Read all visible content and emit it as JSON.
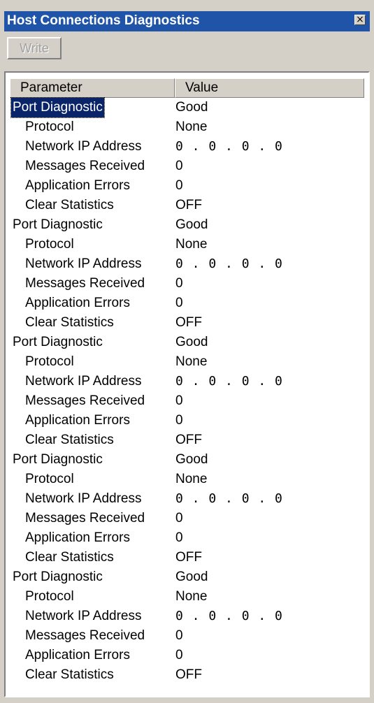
{
  "window": {
    "title": "Host Connections Diagnostics",
    "close_glyph": "×"
  },
  "toolbar": {
    "write_label": "Write"
  },
  "table": {
    "columns": [
      "Parameter",
      "Value"
    ],
    "rows": [
      {
        "parameter": "Port Diagnostic",
        "value": "Good",
        "level": 0,
        "selected": true
      },
      {
        "parameter": "Protocol",
        "value": "None",
        "level": 1
      },
      {
        "parameter": "Network IP Address",
        "value": "0 . 0 . 0 . 0",
        "level": 1
      },
      {
        "parameter": "Messages Received",
        "value": "0",
        "level": 1
      },
      {
        "parameter": "Application Errors",
        "value": "0",
        "level": 1
      },
      {
        "parameter": "Clear Statistics",
        "value": "OFF",
        "level": 1
      },
      {
        "parameter": "Port Diagnostic",
        "value": "Good",
        "level": 0
      },
      {
        "parameter": "Protocol",
        "value": "None",
        "level": 1
      },
      {
        "parameter": "Network IP Address",
        "value": "0 . 0 . 0 . 0",
        "level": 1
      },
      {
        "parameter": "Messages Received",
        "value": "0",
        "level": 1
      },
      {
        "parameter": "Application Errors",
        "value": "0",
        "level": 1
      },
      {
        "parameter": "Clear Statistics",
        "value": "OFF",
        "level": 1
      },
      {
        "parameter": "Port Diagnostic",
        "value": "Good",
        "level": 0
      },
      {
        "parameter": "Protocol",
        "value": "None",
        "level": 1
      },
      {
        "parameter": "Network IP Address",
        "value": "0 . 0 . 0 . 0",
        "level": 1
      },
      {
        "parameter": "Messages Received",
        "value": "0",
        "level": 1
      },
      {
        "parameter": "Application Errors",
        "value": "0",
        "level": 1
      },
      {
        "parameter": "Clear Statistics",
        "value": "OFF",
        "level": 1
      },
      {
        "parameter": "Port Diagnostic",
        "value": "Good",
        "level": 0
      },
      {
        "parameter": "Protocol",
        "value": "None",
        "level": 1
      },
      {
        "parameter": "Network IP Address",
        "value": "0 . 0 . 0 . 0",
        "level": 1
      },
      {
        "parameter": "Messages Received",
        "value": "0",
        "level": 1
      },
      {
        "parameter": "Application Errors",
        "value": "0",
        "level": 1
      },
      {
        "parameter": "Clear Statistics",
        "value": "OFF",
        "level": 1
      },
      {
        "parameter": "Port Diagnostic",
        "value": "Good",
        "level": 0
      },
      {
        "parameter": "Protocol",
        "value": "None",
        "level": 1
      },
      {
        "parameter": "Network IP Address",
        "value": "0 . 0 . 0 . 0",
        "level": 1
      },
      {
        "parameter": "Messages Received",
        "value": "0",
        "level": 1
      },
      {
        "parameter": "Application Errors",
        "value": "0",
        "level": 1
      },
      {
        "parameter": "Clear Statistics",
        "value": "OFF",
        "level": 1
      }
    ]
  },
  "colors": {
    "titlebar": "#1f54a8",
    "selection": "#0a246a",
    "face": "#d4d0c8"
  }
}
